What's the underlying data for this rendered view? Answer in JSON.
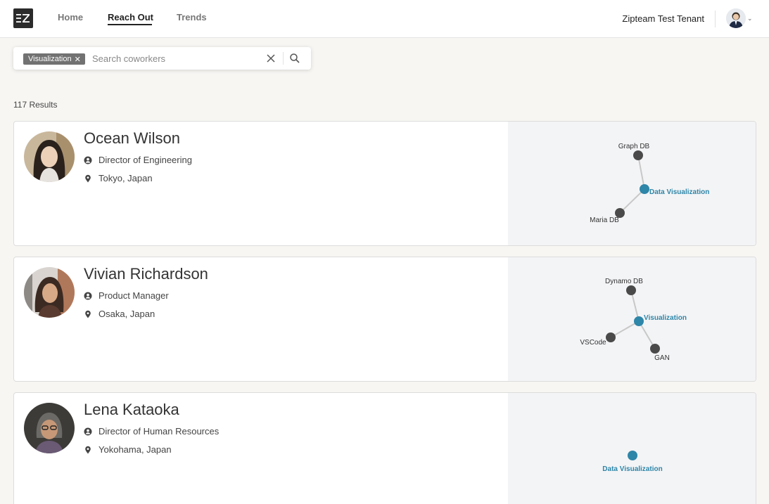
{
  "header": {
    "logo_text": "EZ",
    "nav": [
      "Home",
      "Reach Out",
      "Trends"
    ],
    "active_nav": "Reach Out",
    "tenant": "Zipteam Test Tenant"
  },
  "search": {
    "chip_label": "Visualization",
    "placeholder": "Search coworkers",
    "value": ""
  },
  "results": {
    "count_label": "117 Results"
  },
  "colors": {
    "accent": "#2e86a8",
    "node": "#4a4a4a",
    "edge": "#c8c8c8"
  },
  "people": [
    {
      "name": "Ocean Wilson",
      "title": "Director of Engineering",
      "location": "Tokyo, Japan",
      "graph": {
        "center": "Data Visualization",
        "nodes": [
          "Graph DB",
          "Maria DB"
        ]
      }
    },
    {
      "name": "Vivian Richardson",
      "title": "Product Manager",
      "location": "Osaka, Japan",
      "graph": {
        "center": "Visualization",
        "nodes": [
          "Dynamo DB",
          "VSCode",
          "GAN"
        ]
      }
    },
    {
      "name": "Lena Kataoka",
      "title": "Director of Human Resources",
      "location": "Yokohama, Japan",
      "graph": {
        "center": "Data Visualization",
        "nodes": []
      }
    }
  ]
}
